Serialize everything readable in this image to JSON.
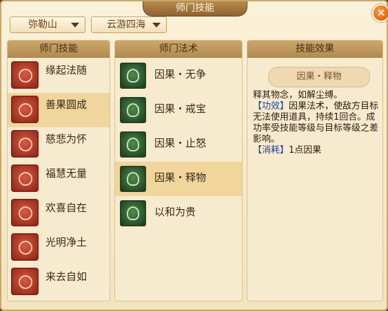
{
  "window": {
    "title": "师门技能",
    "close_symbol": "×"
  },
  "filters": {
    "mountain": "弥勒山",
    "travel": "云游四海"
  },
  "left_panel": {
    "header": "师门技能",
    "items": [
      {
        "label": "缘起法随",
        "icon": "skill-icon"
      },
      {
        "label": "善果圆成",
        "icon": "skill-icon",
        "selected": true
      },
      {
        "label": "慈悲为怀",
        "icon": "skill-icon"
      },
      {
        "label": "福慧无量",
        "icon": "skill-icon"
      },
      {
        "label": "欢喜自在",
        "icon": "skill-icon"
      },
      {
        "label": "光明净土",
        "icon": "skill-icon"
      },
      {
        "label": "来去自如",
        "icon": "skill-icon"
      }
    ]
  },
  "middle_panel": {
    "header": "师门法术",
    "items": [
      {
        "label": "因果・无争",
        "icon": "spell-icon"
      },
      {
        "label": "因果・戒宝",
        "icon": "spell-icon"
      },
      {
        "label": "因果・止怒",
        "icon": "spell-icon"
      },
      {
        "label": "因果・释物",
        "icon": "spell-icon",
        "selected": true
      },
      {
        "label": "以和为贵",
        "icon": "spell-icon"
      }
    ]
  },
  "right_panel": {
    "header": "技能效果",
    "skill_name": "因果・释物",
    "description": "释其物念，如解尘缚。",
    "effect_tag": "【功效】",
    "effect_text": "因果法术，使敌方目标无法使用道具，持续1回合。成功率受技能等级与目标等级之差影响。",
    "cost_tag": "【消耗】",
    "cost_text": "1点因果"
  },
  "colors": {
    "selected_row": "#f0d59d",
    "highlight_blue": "#1c3f9f",
    "skill_icon": "#b33a2a",
    "spell_icon": "#3b6a3a"
  }
}
